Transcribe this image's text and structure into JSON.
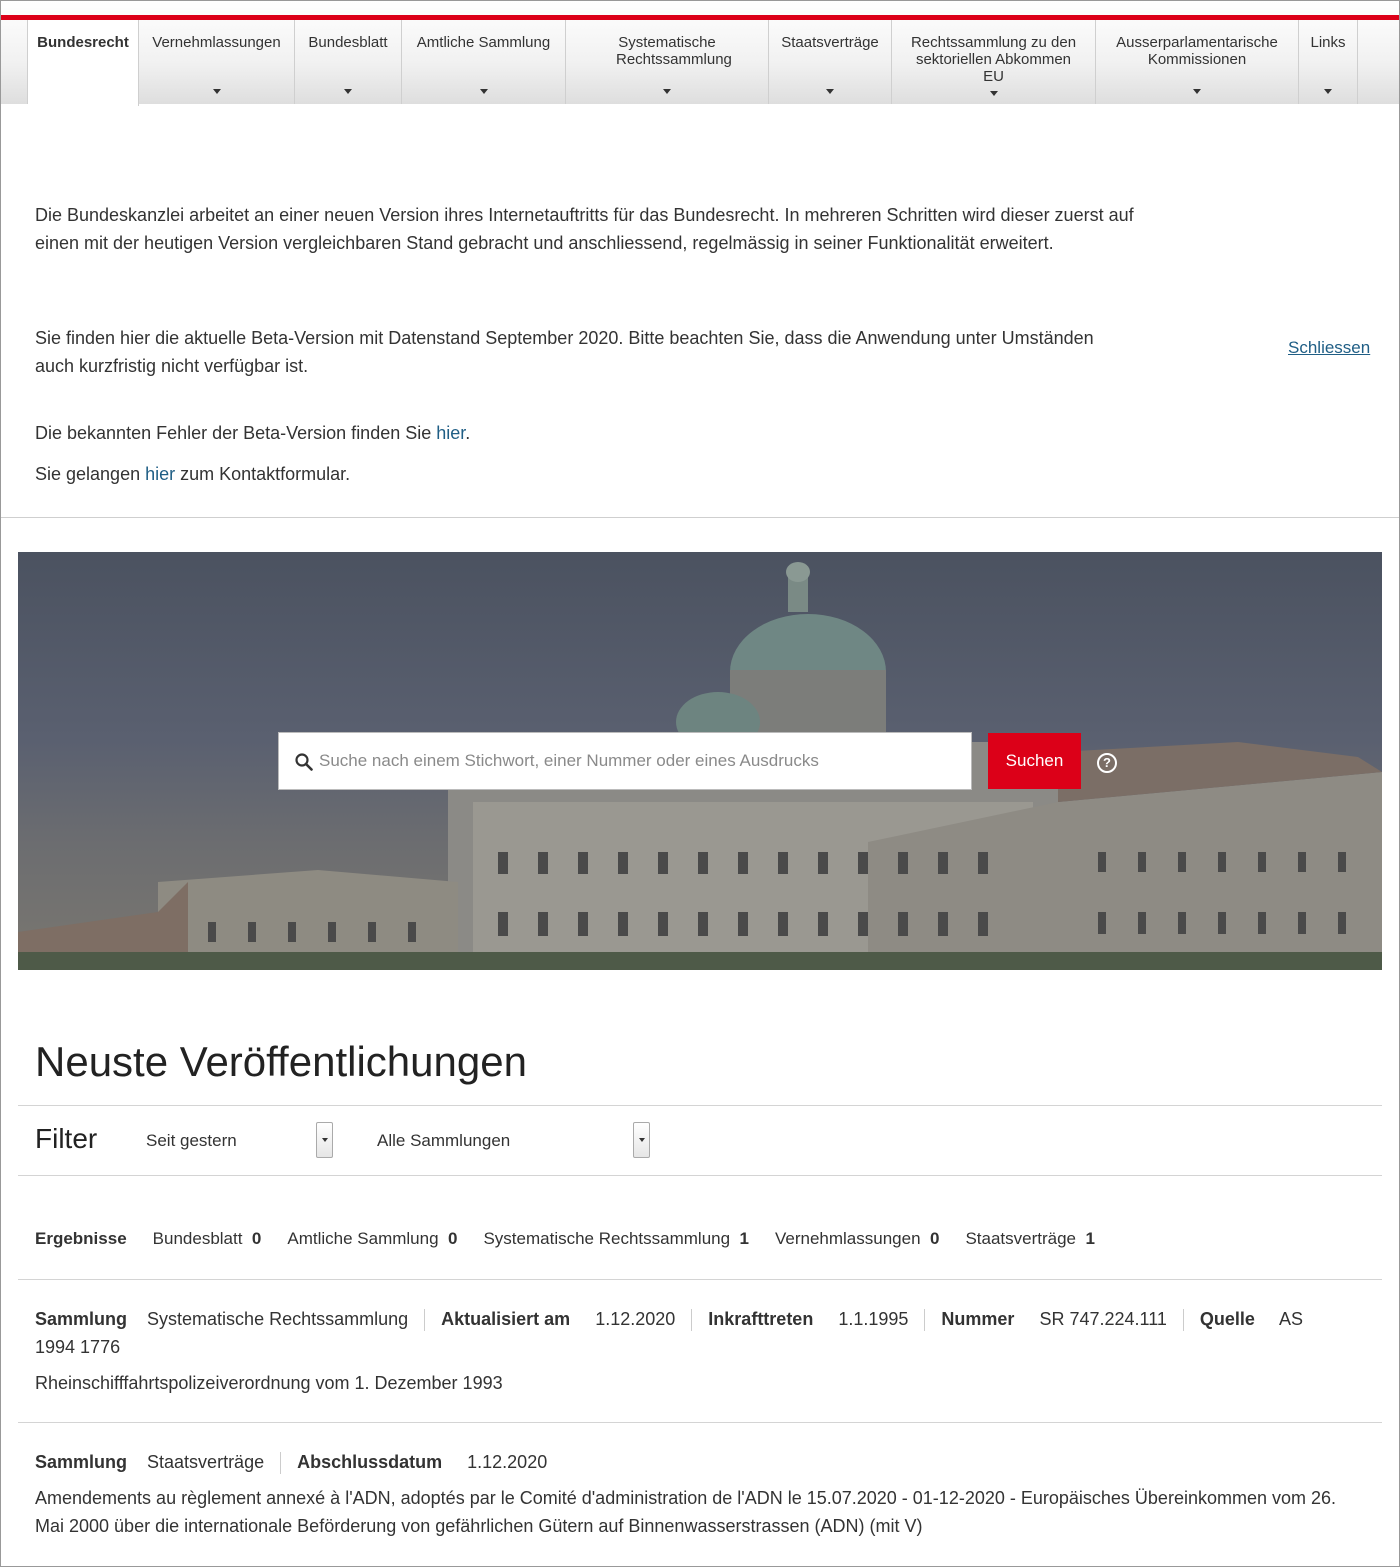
{
  "nav": {
    "items": [
      {
        "label": "Bundesrecht",
        "active": true
      },
      {
        "label": "Vernehmlassungen"
      },
      {
        "label": "Bundesblatt"
      },
      {
        "label": "Amtliche Sammlung"
      },
      {
        "label": "Systematische Rechtssammlung"
      },
      {
        "label": "Staatsverträge"
      },
      {
        "label": "Rechtssammlung zu den sektoriellen Abkommen EU"
      },
      {
        "label": "Ausserparlamentarische Kommissionen"
      },
      {
        "label": "Links"
      }
    ]
  },
  "notice": {
    "p1": "Die Bundeskanzlei arbeitet an einer neuen Version ihres Internetauftritts für das Bundesrecht. In mehreren Schritten wird dieser zuerst auf einen mit der heutigen Version vergleichbaren Stand gebracht und anschliessend, regelmässig in seiner Funktionalität erweitert.",
    "p2": "Sie finden hier die aktuelle Beta-Version mit Datenstand September 2020. Bitte beachten Sie, dass die Anwendung unter Umständen auch kurzfristig nicht verfügbar ist.",
    "p3_before": "Die bekannten Fehler der Beta-Version finden Sie ",
    "p3_link": "hier",
    "p3_after": ".",
    "p4_before": "Sie gelangen ",
    "p4_link": "hier",
    "p4_after": " zum Kontaktformular.",
    "close": "Schliessen"
  },
  "search": {
    "placeholder": "Suche nach einem Stichwort, einer Nummer oder eines Ausdrucks",
    "button": "Suchen",
    "help": "?"
  },
  "publications": {
    "title": "Neuste Veröffentlichungen",
    "filter_label": "Filter",
    "filter_time": "Seit gestern",
    "filter_collection": "Alle Sammlungen",
    "results_label": "Ergebnisse",
    "results": [
      {
        "name": "Bundesblatt",
        "count": "0"
      },
      {
        "name": "Amtliche Sammlung",
        "count": "0"
      },
      {
        "name": "Systematische Rechtssammlung",
        "count": "1"
      },
      {
        "name": "Vernehmlassungen",
        "count": "0"
      },
      {
        "name": "Staatsverträge",
        "count": "1"
      }
    ],
    "entry1": {
      "k_sammlung": "Sammlung",
      "v_sammlung": "Systematische Rechtssammlung",
      "k_updated": "Aktualisiert am",
      "v_updated": "1.12.2020",
      "k_inkraft": "Inkrafttreten",
      "v_inkraft": "1.1.1995",
      "k_nummer": "Nummer",
      "v_nummer": "SR 747.224.111",
      "k_quelle": "Quelle",
      "v_quelle_1": "AS",
      "v_quelle_2": "1994 1776",
      "title": "Rheinschifffahrtspolizeiverordnung vom 1. Dezember 1993"
    },
    "entry2": {
      "k_sammlung": "Sammlung",
      "v_sammlung": "Staatsverträge",
      "k_abschluss": "Abschlussdatum",
      "v_abschluss": "1.12.2020",
      "title": "Amendements au règlement annexé à l'ADN, adoptés par le Comité d'administration de l'ADN le 15.07.2020 - 01-12-2020 - Europäisches Übereinkommen vom 26. Mai 2000 über die internationale Beförderung von gefährlichen Gütern auf Binnenwasserstrassen (ADN) (mit V)"
    }
  }
}
